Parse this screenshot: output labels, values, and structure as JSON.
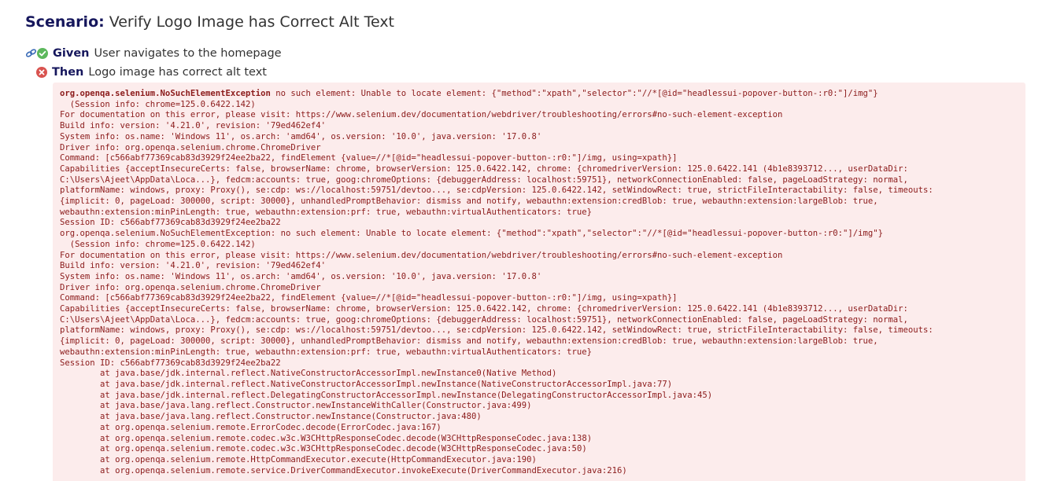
{
  "scenario": {
    "keyword": "Scenario:",
    "name": "Verify Logo Image has Correct Alt Text"
  },
  "steps": [
    {
      "keyword": "Given",
      "text": "User navigates to the homepage",
      "status": "passed",
      "status_color": "#5cb85c",
      "icons": [
        "link-icon",
        "check-circle-icon"
      ]
    },
    {
      "keyword": "Then",
      "text": "Logo image has correct alt text",
      "status": "failed",
      "status_color": "#d9534f",
      "icons": [
        "error-circle-icon"
      ]
    }
  ],
  "error": {
    "exception_name": "org.openqa.selenium.NoSuchElementException",
    "message": " no such element: Unable to locate element: {\"method\":\"xpath\",\"selector\":\"//*[@id=\"headlessui-popover-button-:r0:\"]/img\"}\n  (Session info: chrome=125.0.6422.142)\nFor documentation on this error, please visit: https://www.selenium.dev/documentation/webdriver/troubleshooting/errors#no-such-element-exception\nBuild info: version: '4.21.0', revision: '79ed462ef4'\nSystem info: os.name: 'Windows 11', os.arch: 'amd64', os.version: '10.0', java.version: '17.0.8'\nDriver info: org.openqa.selenium.chrome.ChromeDriver\nCommand: [c566abf77369cab83d3929f24ee2ba22, findElement {value=//*[@id=\"headlessui-popover-button-:r0:\"]/img, using=xpath}]\nCapabilities {acceptInsecureCerts: false, browserName: chrome, browserVersion: 125.0.6422.142, chrome: {chromedriverVersion: 125.0.6422.141 (4b1e8393712..., userDataDir:\nC:\\Users\\Ajeet\\AppData\\Loca...}, fedcm:accounts: true, goog:chromeOptions: {debuggerAddress: localhost:59751}, networkConnectionEnabled: false, pageLoadStrategy: normal,\nplatformName: windows, proxy: Proxy(), se:cdp: ws://localhost:59751/devtoo..., se:cdpVersion: 125.0.6422.142, setWindowRect: true, strictFileInteractability: false, timeouts:\n{implicit: 0, pageLoad: 300000, script: 30000}, unhandledPromptBehavior: dismiss and notify, webauthn:extension:credBlob: true, webauthn:extension:largeBlob: true,\nwebauthn:extension:minPinLength: true, webauthn:extension:prf: true, webauthn:virtualAuthenticators: true}\nSession ID: c566abf77369cab83d3929f24ee2ba22\norg.openqa.selenium.NoSuchElementException: no such element: Unable to locate element: {\"method\":\"xpath\",\"selector\":\"//*[@id=\"headlessui-popover-button-:r0:\"]/img\"}\n  (Session info: chrome=125.0.6422.142)\nFor documentation on this error, please visit: https://www.selenium.dev/documentation/webdriver/troubleshooting/errors#no-such-element-exception\nBuild info: version: '4.21.0', revision: '79ed462ef4'\nSystem info: os.name: 'Windows 11', os.arch: 'amd64', os.version: '10.0', java.version: '17.0.8'\nDriver info: org.openqa.selenium.chrome.ChromeDriver\nCommand: [c566abf77369cab83d3929f24ee2ba22, findElement {value=//*[@id=\"headlessui-popover-button-:r0:\"]/img, using=xpath}]\nCapabilities {acceptInsecureCerts: false, browserName: chrome, browserVersion: 125.0.6422.142, chrome: {chromedriverVersion: 125.0.6422.141 (4b1e8393712..., userDataDir:\nC:\\Users\\Ajeet\\AppData\\Loca...}, fedcm:accounts: true, goog:chromeOptions: {debuggerAddress: localhost:59751}, networkConnectionEnabled: false, pageLoadStrategy: normal,\nplatformName: windows, proxy: Proxy(), se:cdp: ws://localhost:59751/devtoo..., se:cdpVersion: 125.0.6422.142, setWindowRect: true, strictFileInteractability: false, timeouts:\n{implicit: 0, pageLoad: 300000, script: 30000}, unhandledPromptBehavior: dismiss and notify, webauthn:extension:credBlob: true, webauthn:extension:largeBlob: true,\nwebauthn:extension:minPinLength: true, webauthn:extension:prf: true, webauthn:virtualAuthenticators: true}\nSession ID: c566abf77369cab83d3929f24ee2ba22\n\tat java.base/jdk.internal.reflect.NativeConstructorAccessorImpl.newInstance0(Native Method)\n\tat java.base/jdk.internal.reflect.NativeConstructorAccessorImpl.newInstance(NativeConstructorAccessorImpl.java:77)\n\tat java.base/jdk.internal.reflect.DelegatingConstructorAccessorImpl.newInstance(DelegatingConstructorAccessorImpl.java:45)\n\tat java.base/java.lang.reflect.Constructor.newInstanceWithCaller(Constructor.java:499)\n\tat java.base/java.lang.reflect.Constructor.newInstance(Constructor.java:480)\n\tat org.openqa.selenium.remote.ErrorCodec.decode(ErrorCodec.java:167)\n\tat org.openqa.selenium.remote.codec.w3c.W3CHttpResponseCodec.decode(W3CHttpResponseCodec.java:138)\n\tat org.openqa.selenium.remote.codec.w3c.W3CHttpResponseCodec.decode(W3CHttpResponseCodec.java:50)\n\tat org.openqa.selenium.remote.HttpCommandExecutor.execute(HttpCommandExecutor.java:190)\n\tat org.openqa.selenium.remote.service.DriverCommandExecutor.invokeExecute(DriverCommandExecutor.java:216)"
  }
}
